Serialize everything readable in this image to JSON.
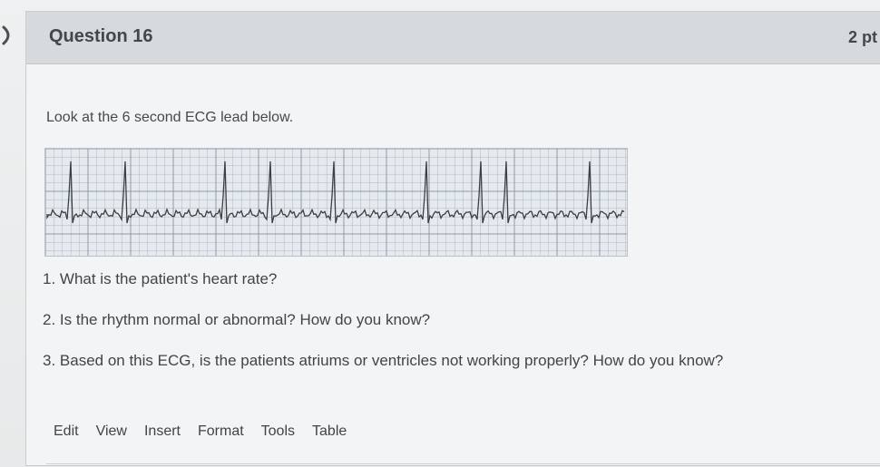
{
  "question": {
    "title": "Question 16",
    "points": "2 pt",
    "prompt": "Look at the 6 second ECG lead below."
  },
  "ecg": {
    "image_description": "ECG rhythm strip",
    "r_peak_count": 10
  },
  "questions": [
    "1. What is the patient's heart rate?",
    "2. Is the rhythm normal or abnormal? How do you know?",
    "3. Based on this ECG, is the patients atriums or ventricles not working properly? How do you know?"
  ],
  "editor_menu": [
    "Edit",
    "View",
    "Insert",
    "Format",
    "Tools",
    "Table"
  ],
  "colors": {
    "background": "#e9ebec",
    "header": "#d7dadc",
    "grid": "#aab6c2",
    "trace": "#3a3f44"
  }
}
